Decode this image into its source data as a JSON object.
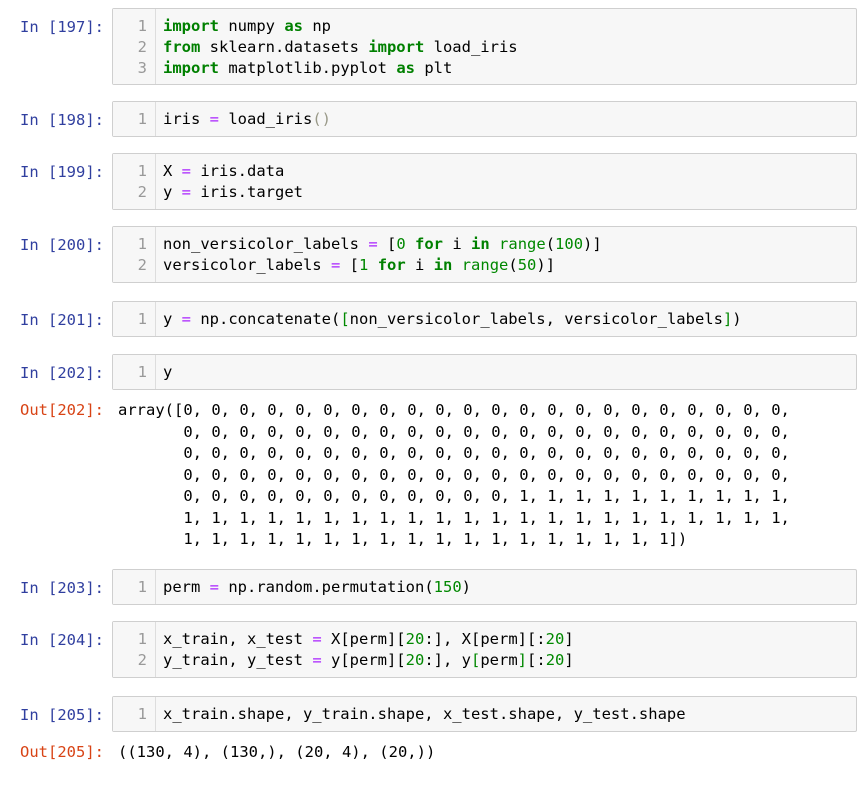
{
  "cells": [
    {
      "id": "197",
      "in_prompt": "In [197]:",
      "lines": [
        [
          "1",
          [
            [
              "kw",
              "import"
            ],
            [
              "t",
              " numpy "
            ],
            [
              "kw",
              "as"
            ],
            [
              "t",
              " np"
            ]
          ]
        ],
        [
          "2",
          [
            [
              "kw",
              "from"
            ],
            [
              "t",
              " sklearn.datasets "
            ],
            [
              "kw",
              "import"
            ],
            [
              "t",
              " load_iris"
            ]
          ]
        ],
        [
          "3",
          [
            [
              "kw",
              "import"
            ],
            [
              "t",
              " matplotlib.pyplot "
            ],
            [
              "kw",
              "as"
            ],
            [
              "t",
              " plt"
            ]
          ]
        ]
      ]
    },
    {
      "id": "198",
      "in_prompt": "In [198]:",
      "lines": [
        [
          "1",
          [
            [
              "t",
              "iris "
            ],
            [
              "op",
              "="
            ],
            [
              "t",
              " load_iris"
            ],
            [
              "br",
              "()"
            ]
          ]
        ]
      ]
    },
    {
      "id": "199",
      "in_prompt": "In [199]:",
      "lines": [
        [
          "1",
          [
            [
              "t",
              "X "
            ],
            [
              "op",
              "="
            ],
            [
              "t",
              " iris.data"
            ]
          ]
        ],
        [
          "2",
          [
            [
              "t",
              "y "
            ],
            [
              "op",
              "="
            ],
            [
              "t",
              " iris.target"
            ]
          ]
        ]
      ]
    },
    {
      "id": "200",
      "in_prompt": "In [200]:",
      "lines": [
        [
          "1",
          [
            [
              "t",
              "non_versicolor_labels "
            ],
            [
              "op",
              "="
            ],
            [
              "t",
              " ["
            ],
            [
              "num",
              "0"
            ],
            [
              "t",
              " "
            ],
            [
              "kw",
              "for"
            ],
            [
              "t",
              " i "
            ],
            [
              "kw",
              "in"
            ],
            [
              "t",
              " "
            ],
            [
              "num",
              "range"
            ],
            [
              "t",
              "("
            ],
            [
              "num",
              "100"
            ],
            [
              "t",
              ")]"
            ]
          ]
        ],
        [
          "2",
          [
            [
              "t",
              "versicolor_labels "
            ],
            [
              "op",
              "="
            ],
            [
              "t",
              " ["
            ],
            [
              "num",
              "1"
            ],
            [
              "t",
              " "
            ],
            [
              "kw",
              "for"
            ],
            [
              "t",
              " i "
            ],
            [
              "kw",
              "in"
            ],
            [
              "t",
              " "
            ],
            [
              "num",
              "range"
            ],
            [
              "t",
              "("
            ],
            [
              "num",
              "50"
            ],
            [
              "t",
              ")]"
            ]
          ]
        ]
      ]
    },
    {
      "id": "201",
      "in_prompt": "In [201]:",
      "lines": [
        [
          "1",
          [
            [
              "t",
              "y "
            ],
            [
              "op",
              "="
            ],
            [
              "t",
              " np.concatenate("
            ],
            [
              "num",
              "["
            ],
            [
              "t",
              "non_versicolor_labels, versicolor_labels"
            ],
            [
              "num",
              "]"
            ],
            [
              "t",
              ")"
            ]
          ]
        ]
      ]
    },
    {
      "id": "202",
      "in_prompt": "In [202]:",
      "lines": [
        [
          "1",
          [
            [
              "t",
              "y"
            ]
          ]
        ]
      ],
      "out_prompt": "Out[202]:",
      "out_lines": [
        "array([0, 0, 0, 0, 0, 0, 0, 0, 0, 0, 0, 0, 0, 0, 0, 0, 0, 0, 0, 0, 0, 0,",
        "       0, 0, 0, 0, 0, 0, 0, 0, 0, 0, 0, 0, 0, 0, 0, 0, 0, 0, 0, 0, 0, 0,",
        "       0, 0, 0, 0, 0, 0, 0, 0, 0, 0, 0, 0, 0, 0, 0, 0, 0, 0, 0, 0, 0, 0,",
        "       0, 0, 0, 0, 0, 0, 0, 0, 0, 0, 0, 0, 0, 0, 0, 0, 0, 0, 0, 0, 0, 0,",
        "       0, 0, 0, 0, 0, 0, 0, 0, 0, 0, 0, 0, 1, 1, 1, 1, 1, 1, 1, 1, 1, 1,",
        "       1, 1, 1, 1, 1, 1, 1, 1, 1, 1, 1, 1, 1, 1, 1, 1, 1, 1, 1, 1, 1, 1,",
        "       1, 1, 1, 1, 1, 1, 1, 1, 1, 1, 1, 1, 1, 1, 1, 1, 1, 1])"
      ]
    },
    {
      "id": "203",
      "in_prompt": "In [203]:",
      "lines": [
        [
          "1",
          [
            [
              "t",
              "perm "
            ],
            [
              "op",
              "="
            ],
            [
              "t",
              " np.random.permutation("
            ],
            [
              "num",
              "150"
            ],
            [
              "t",
              ")"
            ]
          ]
        ]
      ]
    },
    {
      "id": "204",
      "in_prompt": "In [204]:",
      "lines": [
        [
          "1",
          [
            [
              "t",
              "x_train, x_test "
            ],
            [
              "op",
              "="
            ],
            [
              "t",
              " X[perm]["
            ],
            [
              "num",
              "20"
            ],
            [
              "t",
              ":], X[perm][:"
            ],
            [
              "num",
              "20"
            ],
            [
              "t",
              "]"
            ]
          ]
        ],
        [
          "2",
          [
            [
              "t",
              "y_train, y_test "
            ],
            [
              "op",
              "="
            ],
            [
              "t",
              " y[perm]["
            ],
            [
              "num",
              "20"
            ],
            [
              "t",
              ":], y"
            ],
            [
              "num",
              "["
            ],
            [
              "t",
              "perm"
            ],
            [
              "num",
              "]"
            ],
            [
              "t",
              "[:"
            ],
            [
              "num",
              "20"
            ],
            [
              "t",
              "]"
            ]
          ]
        ]
      ]
    },
    {
      "id": "205",
      "in_prompt": "In [205]:",
      "lines": [
        [
          "1",
          [
            [
              "t",
              "x_train.shape, y_train.shape, x_test.shape, y_test.shape"
            ]
          ]
        ]
      ],
      "out_prompt": "Out[205]:",
      "out_lines": [
        "((130, 4), (130,), (20, 4), (20,))"
      ]
    }
  ]
}
